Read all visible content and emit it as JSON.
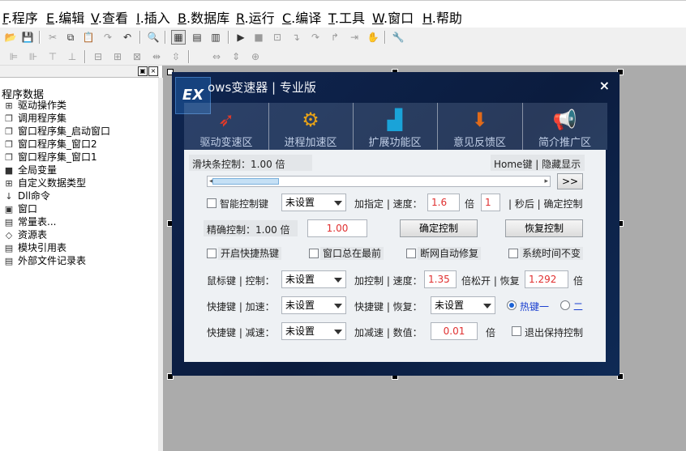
{
  "menu": [
    {
      "key": "F",
      "label": ".程序"
    },
    {
      "key": "E",
      "label": ".编辑"
    },
    {
      "key": "V",
      "label": ".查看"
    },
    {
      "key": "I",
      "label": ".插入"
    },
    {
      "key": "B",
      "label": ".数据库"
    },
    {
      "key": "R",
      "label": ".运行"
    },
    {
      "key": "C",
      "label": ".编译"
    },
    {
      "key": "T",
      "label": ".工具"
    },
    {
      "key": "W",
      "label": ".窗口"
    },
    {
      "key": "H",
      "label": ".帮助"
    }
  ],
  "left_panel": {
    "header_pin": "▣",
    "header_close": "×",
    "root_label": "程序数据",
    "items": [
      {
        "icon": "⊞",
        "label": "驱动操作类"
      },
      {
        "icon": "❐",
        "label": "调用程序集"
      },
      {
        "icon": "❐",
        "label": "窗口程序集_启动窗口"
      },
      {
        "icon": "❐",
        "label": "窗口程序集_窗口2"
      },
      {
        "icon": "❐",
        "label": "窗口程序集_窗口1"
      },
      {
        "icon": "■",
        "label": "全局变量"
      },
      {
        "icon": "⊞",
        "label": "自定义数据类型"
      },
      {
        "icon": "↓",
        "label": "Dll命令"
      },
      {
        "icon": "▣",
        "label": "窗口"
      },
      {
        "icon": "▤",
        "label": "常量表..."
      },
      {
        "icon": "◇",
        "label": "资源表"
      },
      {
        "icon": "▤",
        "label": "模块引用表"
      },
      {
        "icon": "▤",
        "label": "外部文件记录表"
      }
    ]
  },
  "app": {
    "logo": "EX",
    "title": "ows变速器 | 专业版",
    "close": "×",
    "tabs": [
      {
        "label": "驱动变速区",
        "icon": "rocket-icon",
        "glyph": "🚀",
        "color": "#e03a2a"
      },
      {
        "label": "进程加速区",
        "icon": "gear-check-icon",
        "glyph": "⚙",
        "color": "#e8a317"
      },
      {
        "label": "扩展功能区",
        "icon": "bar-chart-icon",
        "glyph": "▟",
        "color": "#1aa3d8"
      },
      {
        "label": "意见反馈区",
        "icon": "download-icon",
        "glyph": "⬇",
        "color": "#e06a1a"
      },
      {
        "label": "简介推广区",
        "icon": "megaphone-icon",
        "glyph": "📢",
        "color": "#d83a3a"
      }
    ],
    "slider_title": "滑块条控制：1.00 倍",
    "home_hint": "Home键 | 隐藏显示",
    "slider_value_percent": 8,
    "slider_more": ">>",
    "smart_label": "智能控制键",
    "smart_value": "未设置",
    "specify_label": "加指定 | 速度：",
    "specify_speed": "1.6",
    "times": "倍",
    "specify_seconds": "1",
    "seconds_suffix": "| 秒后 | 确定控制",
    "precise_label": "精确控制：1.00 倍",
    "precise_value": "1.00",
    "confirm_btn": "确定控制",
    "restore_btn": "恢复控制",
    "hotkey_check": "开启快捷热键",
    "topmost_check": "窗口总在最前",
    "offline_check": "断网自动修复",
    "systime_check": "系统时间不变",
    "mouse_label": "鼠标键 | 控制：",
    "mouse_value": "未设置",
    "add_ctrl_label": "加控制 | 速度：",
    "add_ctrl_speed": "1.35",
    "release_label": "倍松开 | 恢复",
    "release_value": "1.292",
    "quick_accel_label": "快捷键 | 加速：",
    "quick_accel_value": "未设置",
    "quick_restore_label": "快捷键 | 恢复：",
    "quick_restore_value": "未设置",
    "hotkey1": "热键一",
    "hotkey2": "二",
    "quick_decel_label": "快捷键 | 减速：",
    "quick_decel_value": "未设置",
    "decel_label": "加减速 | 数值：",
    "decel_value": "0.01",
    "exit_keep": "退出保持控制"
  }
}
